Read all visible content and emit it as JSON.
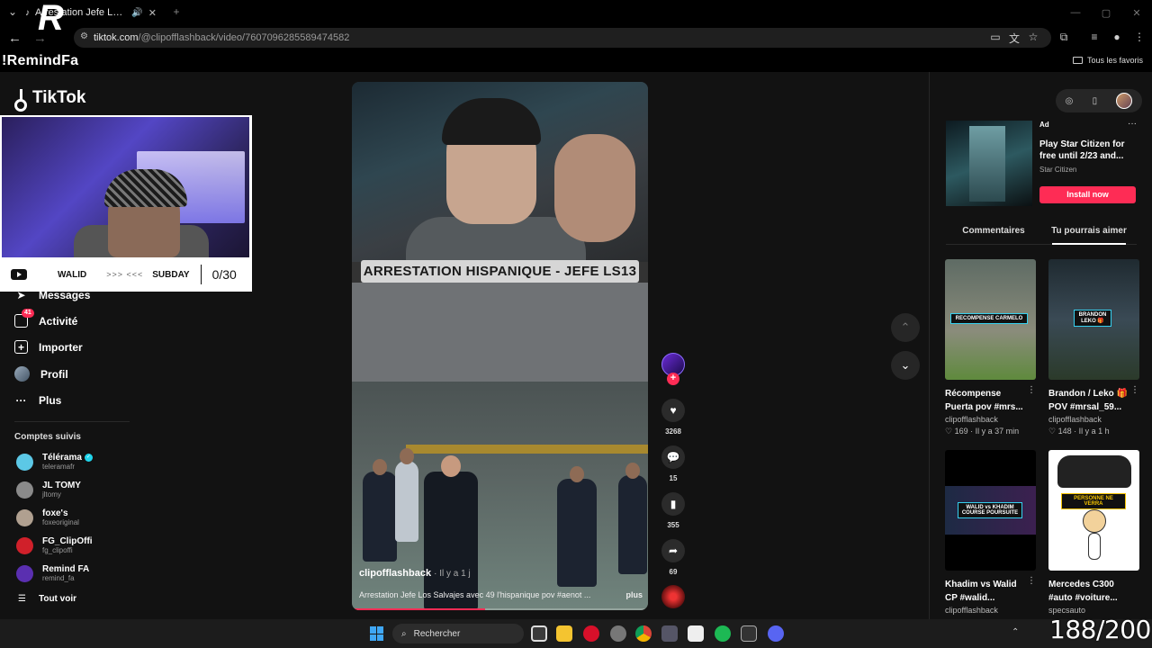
{
  "browser": {
    "tab_title": "Arrestation Jefe Los Salvajes",
    "url_host": "tiktok.com",
    "url_path": "/@clipofflashback/video/7607096285589474582",
    "bookmark_folder": "Tous les favoris"
  },
  "overlay": {
    "streamer_name": "!RemindFa",
    "cam_name_left": "WALID",
    "cam_arrows": ">>> <<<",
    "cam_name_right": "SUBDAY",
    "cam_score": "0/30",
    "corner_counter": "188/200"
  },
  "sidebar": {
    "brand": "TikTok",
    "nav": [
      {
        "label": "Messages",
        "icon": "send-icon"
      },
      {
        "label": "Activité",
        "icon": "inbox-icon",
        "badge": "41"
      },
      {
        "label": "Importer",
        "icon": "upload-icon"
      },
      {
        "label": "Profil",
        "icon": "profile-icon"
      },
      {
        "label": "Plus",
        "icon": "more-icon"
      }
    ],
    "following_title": "Comptes suivis",
    "following": [
      {
        "name": "Télérama",
        "handle": "teleramafr",
        "verified": true,
        "color": "#5cc8e6"
      },
      {
        "name": "JL TOMY",
        "handle": "jltomy",
        "verified": false,
        "color": "#8a8a8a"
      },
      {
        "name": "foxe's",
        "handle": "foxeoriginal",
        "verified": false,
        "color": "#b0a090"
      },
      {
        "name": "FG_ClipOffi",
        "handle": "fg_clipoffi",
        "verified": false,
        "color": "#d0202a"
      },
      {
        "name": "Remind FA",
        "handle": "remind_fa",
        "verified": false,
        "color": "#5a2fb0"
      }
    ],
    "see_all": "Tout voir"
  },
  "video": {
    "caption_overlay": "ARRESTATION HISPANIQUE - JEFE LS13",
    "author": "clipofflashback",
    "age": "· Il y a 1 j",
    "description": "Arrestation Jefe Los Salvajes avec 49 l'hispanique pov #aenot ...",
    "more": "plus",
    "progress": 0.45,
    "likes": "3268",
    "comments": "15",
    "saves": "355",
    "shares": "69"
  },
  "right_panel": {
    "ad": {
      "label": "Ad",
      "title": "Play Star Citizen for free until 2/23 and...",
      "brand": "Star Citizen",
      "cta": "Install now"
    },
    "tabs": [
      "Commentaires",
      "Tu pourrais aimer"
    ],
    "active_tab": 1,
    "cards": [
      {
        "title": "Récompense Puerta pov #mrs...",
        "author": "clipofflashback",
        "stats": "♡ 169 · Il y a 37 min",
        "tag": "RECOMPENSE CARMELO"
      },
      {
        "title": "Brandon / Leko 🎁 POV #mrsal_59...",
        "author": "clipofflashback",
        "stats": "♡ 148 · Il y a 1 h",
        "tag": "BRANDON LEKO 🎁"
      },
      {
        "title": "Khadim vs Walid CP #walid...",
        "author": "clipofflashback",
        "stats": "",
        "tag": "WALID vs KHADIM COURSE POURSUITE"
      },
      {
        "title": "Mercedes C300 #auto #voiture...",
        "author": "specsauto",
        "stats": "",
        "tag": "PERSONNE NE VERRA"
      }
    ]
  },
  "taskbar": {
    "search_placeholder": "Rechercher"
  },
  "colors": {
    "accent": "#fe2c55",
    "verified": "#20d5ec",
    "background": "#121212"
  }
}
